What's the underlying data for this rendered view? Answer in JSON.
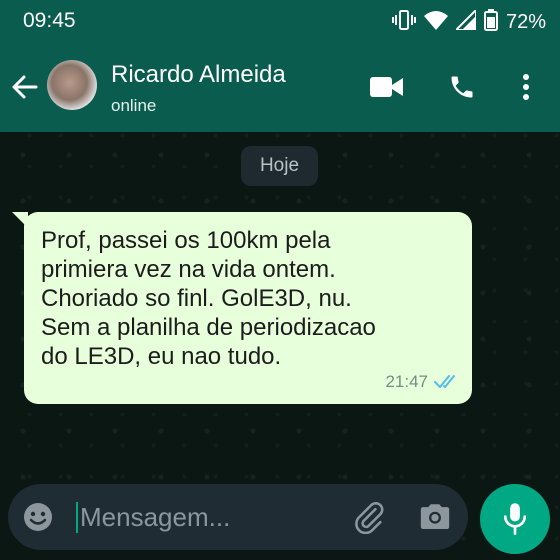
{
  "status_bar": {
    "time": "09:45",
    "battery_percent": "72%",
    "icons": [
      "vibrate-icon",
      "wifi-icon",
      "signal-icon",
      "battery-icon"
    ]
  },
  "header": {
    "contact_name": "Ricardo Almeida",
    "contact_status": "online",
    "icons": [
      "back-arrow-icon",
      "video-call-icon",
      "phone-call-icon",
      "more-options-icon"
    ]
  },
  "chat": {
    "date_chip": "Hoje",
    "message": {
      "lines": [
        "Prof, passei os 100km pela",
        "primiera vez na vida ontem.",
        "Choriado so finl. GolE3D, nu.",
        "Sem a planilha de periodizacao",
        "do LE3D, eu nao tudo."
      ],
      "time": "21:47",
      "status": "read"
    }
  },
  "input_bar": {
    "placeholder": "Mensagem...",
    "icons": [
      "emoji-icon",
      "attach-icon",
      "camera-icon",
      "mic-icon"
    ]
  },
  "colors": {
    "header_bg": "#0a5c4f",
    "chat_bg": "#0b1713",
    "bubble_bg": "#e7ffdb",
    "accent": "#00a884",
    "read_ticks": "#53bdeb"
  }
}
